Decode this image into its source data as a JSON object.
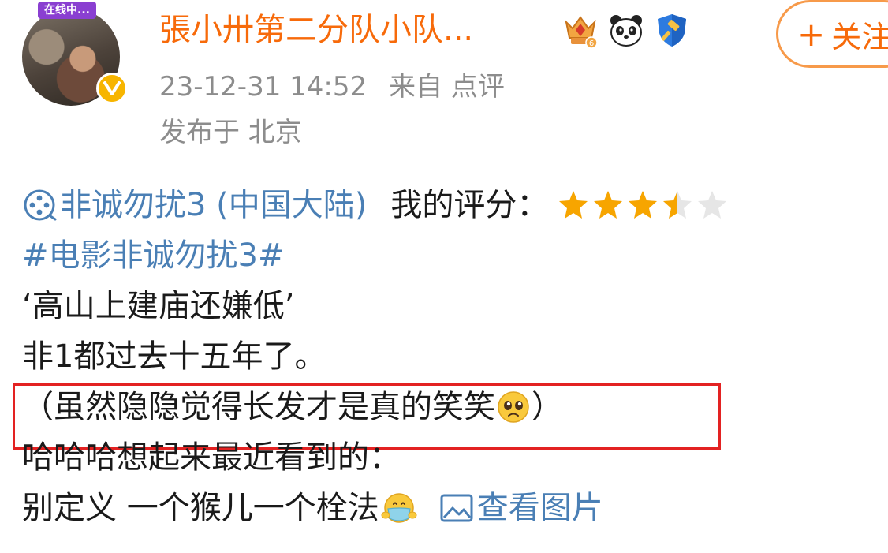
{
  "header": {
    "live_badge": "在线中...",
    "username": "張小卅第二分队小队...",
    "follow_label": "关注",
    "timestamp": "23-12-31 14:52",
    "source": "来自 点评",
    "location": "发布于 北京",
    "badges": [
      "crown-badge-icon",
      "panda-icon",
      "shield-hammer-icon"
    ]
  },
  "post": {
    "movie_link": "非诚勿扰3 (中国大陆)",
    "rating_label": "我的评分：",
    "rating_stars": 3.5,
    "rating_max": 5,
    "hashtag": "#电影非诚勿扰3#",
    "lines": [
      "‘高山上建庙还嫌低’",
      "非1都过去十五年了。",
      "（虽然隐隐觉得长发才是真的笑笑",
      "）",
      "哈哈哈想起来最近看到的：",
      "别定义 一个猴儿一个栓法"
    ],
    "view_image": "查看图片"
  },
  "colors": {
    "username": "#f76a0a",
    "link": "#4a7fb5",
    "meta": "#8c8c8c",
    "star": "#f7a500",
    "highlight": "#e32222"
  }
}
